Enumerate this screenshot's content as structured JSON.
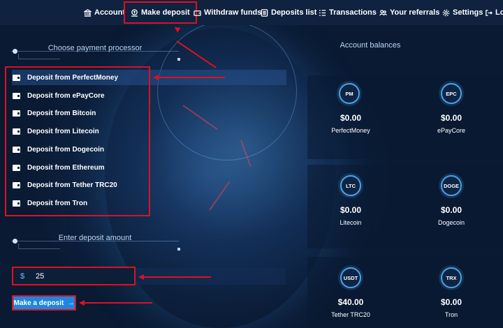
{
  "nav": {
    "items": [
      {
        "label": "Account",
        "icon": "bank-icon"
      },
      {
        "label": "Make deposit",
        "icon": "deposit-icon"
      },
      {
        "label": "Withdraw funds",
        "icon": "wallet-icon"
      },
      {
        "label": "Deposits list",
        "icon": "list-icon"
      },
      {
        "label": "Transactions",
        "icon": "transactions-icon"
      },
      {
        "label": "Your referrals",
        "icon": "referrals-icon"
      },
      {
        "label": "Settings",
        "icon": "gear-icon"
      },
      {
        "label": "Lo",
        "icon": "logout-icon"
      }
    ],
    "active": "Make deposit"
  },
  "payment": {
    "header": "Choose payment processor",
    "processors": [
      "Deposit from PerfectMoney",
      "Deposit from ePayCore",
      "Deposit from Bitcoin",
      "Deposit from Litecoin",
      "Deposit from Dogecoin",
      "Deposit from Ethereum",
      "Deposit from Tether TRC20",
      "Deposit from Tron"
    ],
    "selected": "Deposit from PerfectMoney"
  },
  "amount": {
    "header": "Enter deposit amount",
    "currency_symbol": "$",
    "value": "25",
    "button_label": "Make a deposit",
    "button_arrow": "→"
  },
  "balances": {
    "title": "Account balances",
    "items": [
      {
        "code": "PM",
        "amount": "$0.00",
        "name": "PerfectMoney"
      },
      {
        "code": "EPC",
        "amount": "$0.00",
        "name": "ePayCore"
      },
      {
        "code": "LTC",
        "amount": "$0.00",
        "name": "Litecoin"
      },
      {
        "code": "DOGE",
        "amount": "$0.00",
        "name": "Dogecoin"
      },
      {
        "code": "USDT",
        "amount": "$40.00",
        "name": "Tether TRC20"
      },
      {
        "code": "TRX",
        "amount": "$0.00",
        "name": "Tron"
      }
    ]
  },
  "colors": {
    "background": "#10284a",
    "nav_background": "#0f2240",
    "annotation": "#e0101e",
    "button": "#1f86e0",
    "coin_ring": "#4aa3e8"
  }
}
